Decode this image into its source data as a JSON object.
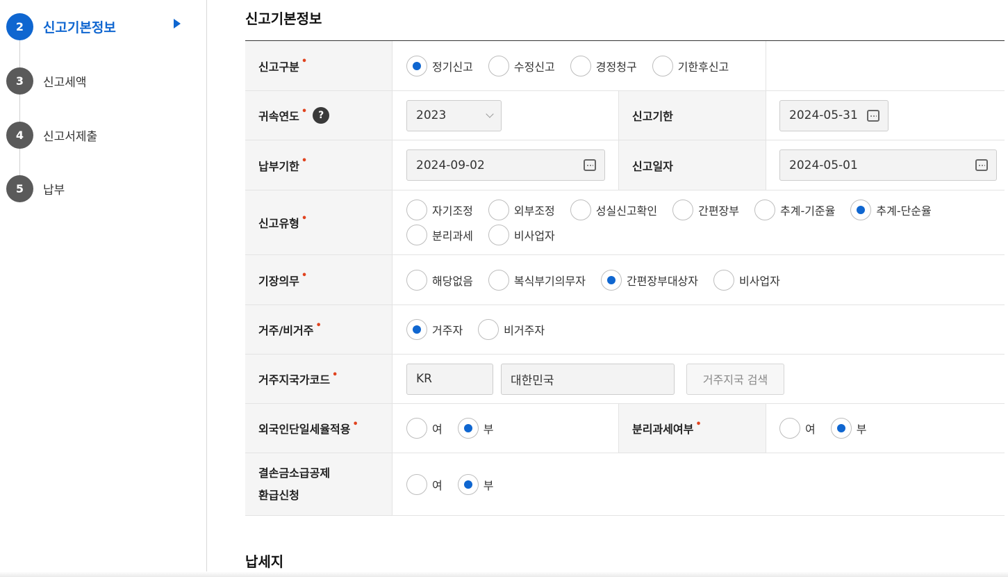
{
  "sidebar": {
    "steps": [
      {
        "num": "2",
        "label": "신고기본정보",
        "active": true
      },
      {
        "num": "3",
        "label": "신고세액"
      },
      {
        "num": "4",
        "label": "신고서제출"
      },
      {
        "num": "5",
        "label": "납부"
      }
    ]
  },
  "section": {
    "title": "신고기본정보",
    "next_title": "납세지"
  },
  "required_mark": "•",
  "help_glyph": "?",
  "form": {
    "report_type": {
      "label": "신고구분",
      "options": [
        "정기신고",
        "수정신고",
        "경정청구",
        "기한후신고"
      ],
      "selected": 0
    },
    "year": {
      "label": "귀속연도",
      "value": "2023"
    },
    "report_deadline": {
      "label": "신고기한",
      "value": "2024-05-31"
    },
    "pay_deadline": {
      "label": "납부기한",
      "value": "2024-09-02"
    },
    "report_date": {
      "label": "신고일자",
      "value": "2024-05-01"
    },
    "filing_type": {
      "label": "신고유형",
      "options": [
        "자기조정",
        "외부조정",
        "성실신고확인",
        "간편장부",
        "추계-기준율",
        "추계-단순율",
        "분리과세",
        "비사업자"
      ],
      "selected": 5
    },
    "bookkeeping": {
      "label": "기장의무",
      "options": [
        "해당없음",
        "복식부기의무자",
        "간편장부대상자",
        "비사업자"
      ],
      "selected": 2
    },
    "residency": {
      "label": "거주/비거주",
      "options": [
        "거주자",
        "비거주자"
      ],
      "selected": 0
    },
    "country_code": {
      "label": "거주지국가코드",
      "code": "KR",
      "name": "대한민국",
      "search_button": "거주지국 검색"
    },
    "foreign_flat_tax": {
      "label": "외국인단일세율적용",
      "options": [
        "여",
        "부"
      ],
      "selected": 1
    },
    "separate_tax": {
      "label": "분리과세여부",
      "options": [
        "여",
        "부"
      ],
      "selected": 1
    },
    "loss_carryback": {
      "label_line1": "결손금소급공제",
      "label_line2": "환급신청",
      "options": [
        "여",
        "부"
      ],
      "selected": 1
    }
  }
}
